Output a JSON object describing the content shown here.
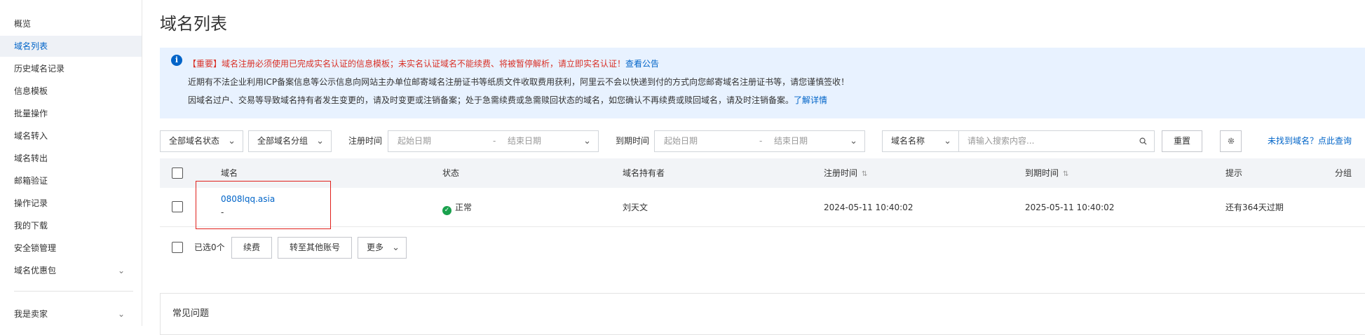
{
  "sidebar": {
    "items": [
      {
        "label": "概览"
      },
      {
        "label": "域名列表"
      },
      {
        "label": "历史域名记录"
      },
      {
        "label": "信息模板"
      },
      {
        "label": "批量操作"
      },
      {
        "label": "域名转入"
      },
      {
        "label": "域名转出"
      },
      {
        "label": "邮箱验证"
      },
      {
        "label": "操作记录"
      },
      {
        "label": "我的下载"
      },
      {
        "label": "安全锁管理"
      },
      {
        "label": "域名优惠包"
      }
    ],
    "bottom_item": "我是卖家"
  },
  "page": {
    "title": "域名列表"
  },
  "notice": {
    "line1_red": "【重要】域名注册必须使用已完成实名认证的信息模板；未实名认证域名不能续费、将被暂停解析，请立即实名认证！",
    "line1_link": "查看公告",
    "line2": "近期有不法企业利用ICP备案信息等公示信息向网站主办单位邮寄域名注册证书等纸质文件收取费用获利，阿里云不会以快递到付的方式向您邮寄域名注册证书等，请您谨慎签收！",
    "line3": "因域名过户、交易等导致域名持有者发生变更的，请及时变更或注销备案；处于急需续费或急需赎回状态的域名，如您确认不再续费或赎回域名，请及时注销备案。",
    "line3_link": "了解详情"
  },
  "filters": {
    "status_select": "全部域名状态",
    "group_select": "全部域名分组",
    "reg_time_label": "注册时间",
    "reg_start_placeholder": "起始日期",
    "reg_end_placeholder": "结束日期",
    "range_sep": "-",
    "exp_time_label": "到期时间",
    "exp_start_placeholder": "起始日期",
    "exp_end_placeholder": "结束日期",
    "search_field_select": "域名名称",
    "search_placeholder": "请输入搜索内容...",
    "reset_button": "重置",
    "not_found_link": "未找到域名？点此查询"
  },
  "table": {
    "headers": {
      "domain": "域名",
      "status": "状态",
      "holder": "域名持有者",
      "reg_time": "注册时间",
      "exp_time": "到期时间",
      "hint": "提示",
      "group": "分组"
    },
    "rows": [
      {
        "domain": "0808lqq.asia",
        "domain_sub": "-",
        "status": "正常",
        "holder": "刘天文",
        "reg_time": "2024-05-11 10:40:02",
        "exp_time": "2025-05-11 10:40:02",
        "hint": "还有364天过期"
      }
    ]
  },
  "bulk": {
    "selected": "已选0个",
    "renew_button": "续费",
    "transfer_button": "转至其他账号",
    "more_button": "更多"
  },
  "faq": {
    "title": "常见问题"
  },
  "colors": {
    "accent": "#0064c8",
    "warning": "#d93026",
    "ok": "#1aa14d",
    "highlight_box": "#e0201b"
  }
}
